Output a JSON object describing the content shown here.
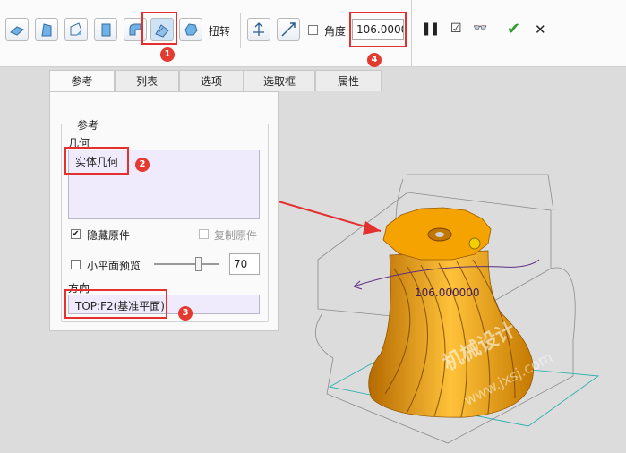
{
  "toolbar": {
    "twist_label": "扭转",
    "angle_checkbox_label": "角度",
    "angle_value": "106.0000",
    "pause_symbol": "❚❚",
    "preview_check_symbol": "☑",
    "glasses_symbol": "👓",
    "ok_symbol": "✔",
    "cancel_symbol": "✕",
    "icons": [
      "extrude-icon",
      "revolve-icon",
      "sweep-icon",
      "blend-icon",
      "swept-blend-icon",
      "warp-icon",
      "spinal-bend-icon",
      "twist-icon",
      "flip-axis-icon",
      "stretch-icon"
    ]
  },
  "badges": [
    "1",
    "2",
    "3",
    "4"
  ],
  "tabs": [
    "参考",
    "列表",
    "选项",
    "选取框",
    "属性"
  ],
  "panel": {
    "group_title": "参考",
    "geometry_label": "几何",
    "geometry_value": "实体几何",
    "hide_original_label": "隐藏原件",
    "hide_original_checked": "✔",
    "copy_original_label": "复制原件",
    "small_plane_label": "小平面预览",
    "small_plane_value": "70",
    "direction_label": "方向",
    "direction_value": "TOP:F2(基准平面)"
  },
  "viewport": {
    "dimension_label": "106.000000",
    "watermark_line1": "机械设计",
    "watermark_line2": "www.jxsj.com"
  },
  "colors": {
    "highlight": "#e53030",
    "model": "#f5a300",
    "checkmark": "#2e9a2e"
  }
}
